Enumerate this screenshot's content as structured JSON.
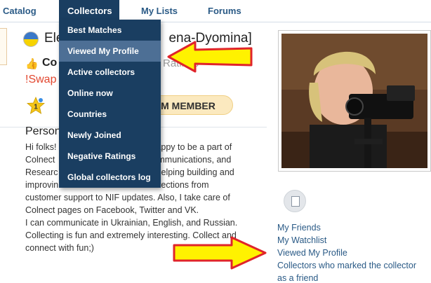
{
  "nav": {
    "catalog": "Catalog",
    "collectors": "Collectors",
    "my_lists": "My Lists",
    "forums": "Forums"
  },
  "dropdown": {
    "items": [
      {
        "label": "Best Matches",
        "active": false
      },
      {
        "label": "Viewed My Profile",
        "active": true
      },
      {
        "label": "Active collectors",
        "active": false
      },
      {
        "label": "Online now",
        "active": false
      },
      {
        "label": "Countries",
        "active": false
      },
      {
        "label": "Newly Joined",
        "active": false
      },
      {
        "label": "Negative Ratings",
        "active": false
      },
      {
        "label": "Global collectors log",
        "active": false
      }
    ]
  },
  "profile": {
    "name_left": "Ele",
    "name_right": "ena-Dyomina]",
    "co_text": "Co",
    "rating_text": "Ratings",
    "swap_text": "!Swap",
    "badge_number": "1",
    "premium_label": "UM MEMBER",
    "person_heading": "Person",
    "bio_lines": [
      [
        "Hi folks!",
        "appy to be a part of"
      ],
      [
        "Colnect",
        "mmunications, and"
      ],
      [
        "Researc",
        "helping building and"
      ],
      [
        "improvin",
        "rections from"
      ],
      [
        "customer support to NIF updates. Also, I take care of",
        ""
      ],
      [
        "Colnect pages on Facebook, Twitter and VK.",
        ""
      ],
      [
        "I can communicate in Ukrainian, English, and Russian.",
        ""
      ],
      [
        "Collecting is fun and extremely interesting. Collect and",
        ""
      ],
      [
        "connect with fun;)",
        ""
      ]
    ]
  },
  "side_links": [
    "My Friends",
    "My Watchlist",
    "Viewed My Profile",
    "Collectors who marked the collector",
    "as a friend"
  ],
  "colors": {
    "nav_dark": "#1a3e61",
    "menu_highlight": "#4d6f95",
    "link": "#2a5a86",
    "swap_red": "#e2472f",
    "arrow_fill": "#fff200",
    "arrow_outline": "#e0242a",
    "premium_bg": "#fbe9bf"
  }
}
